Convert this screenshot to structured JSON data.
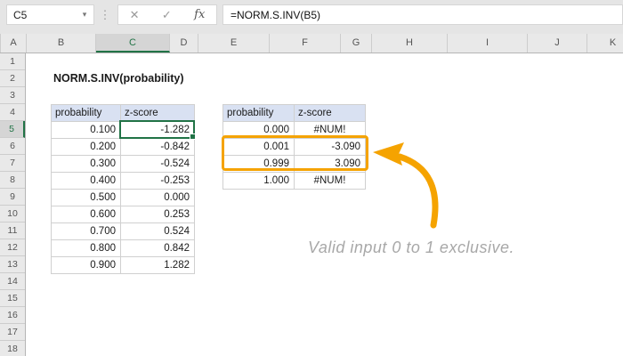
{
  "formula_bar": {
    "name_box_value": "C5",
    "dropdown_icon": "▾",
    "more_dots_icon": "⋮",
    "cancel_icon": "✕",
    "enter_icon": "✓",
    "fx_icon": "fx",
    "formula": "=NORM.S.INV(B5)"
  },
  "grid": {
    "column_headers": [
      "A",
      "B",
      "C",
      "D",
      "E",
      "F",
      "G",
      "H",
      "I",
      "J",
      "K"
    ],
    "row_headers": [
      "1",
      "2",
      "3",
      "4",
      "5",
      "6",
      "7",
      "8",
      "9",
      "10",
      "11",
      "12",
      "13",
      "14",
      "15",
      "16",
      "17",
      "18"
    ],
    "selected_cell": "C5",
    "selected_column": "C",
    "selected_row": "5"
  },
  "sheet": {
    "title": "NORM.S.INV(probability)",
    "left_table": {
      "headers": [
        "probability",
        "z-score"
      ],
      "rows": [
        [
          "0.100",
          "-1.282"
        ],
        [
          "0.200",
          "-0.842"
        ],
        [
          "0.300",
          "-0.524"
        ],
        [
          "0.400",
          "-0.253"
        ],
        [
          "0.500",
          "0.000"
        ],
        [
          "0.600",
          "0.253"
        ],
        [
          "0.700",
          "0.524"
        ],
        [
          "0.800",
          "0.842"
        ],
        [
          "0.900",
          "1.282"
        ]
      ]
    },
    "right_table": {
      "headers": [
        "probability",
        "z-score"
      ],
      "rows": [
        [
          "0.000",
          "#NUM!"
        ],
        [
          "0.001",
          "-3.090"
        ],
        [
          "0.999",
          "3.090"
        ],
        [
          "1.000",
          "#NUM!"
        ]
      ]
    },
    "annotation": "Valid input 0 to 1 exclusive."
  },
  "colors": {
    "selection_green": "#217346",
    "table_header_fill": "#D9E1F2",
    "highlight_orange": "#F5A300",
    "annotation_gray": "#A8A8A8"
  }
}
